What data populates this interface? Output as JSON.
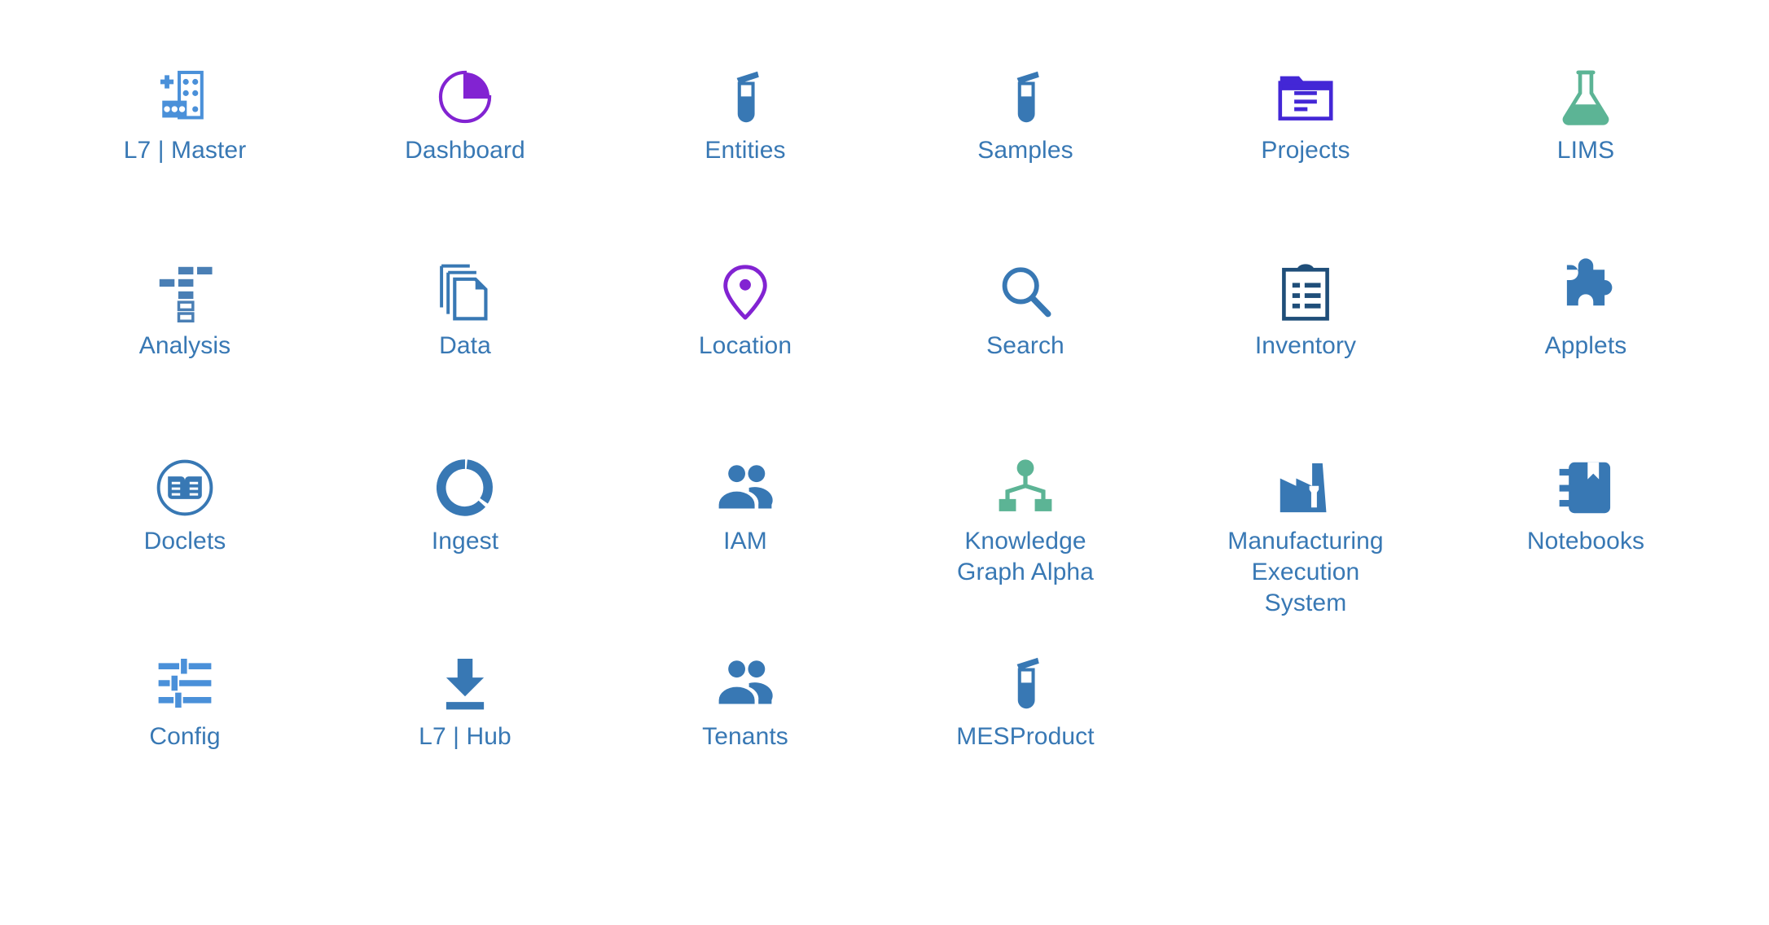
{
  "page": {
    "title": "App Launcher",
    "background_color": "#ffffff",
    "label_color": "#3878b4",
    "columns": 6
  },
  "palette": {
    "blue_light": "#4a90d9",
    "blue_mid": "#3878b4",
    "blue_steel": "#4a7fb5",
    "navy": "#1f4e79",
    "purple": "#8223d2",
    "indigo": "#4327d6",
    "green": "#5cb495"
  },
  "apps": [
    {
      "id": "l7-master",
      "label": "L7 | Master",
      "icon": "master-grid-icon",
      "color": "#4a90d9"
    },
    {
      "id": "dashboard",
      "label": "Dashboard",
      "icon": "pie-chart-icon",
      "color": "#8223d2"
    },
    {
      "id": "entities",
      "label": "Entities",
      "icon": "test-tube-icon",
      "color": "#3878b4"
    },
    {
      "id": "samples",
      "label": "Samples",
      "icon": "test-tube-icon",
      "color": "#3878b4"
    },
    {
      "id": "projects",
      "label": "Projects",
      "icon": "folder-document-icon",
      "color": "#4327d6"
    },
    {
      "id": "lims",
      "label": "LIMS",
      "icon": "flask-icon",
      "color": "#5cb495"
    },
    {
      "id": "analysis",
      "label": "Analysis",
      "icon": "workflow-blocks-icon",
      "color": "#4a7fb5"
    },
    {
      "id": "data",
      "label": "Data",
      "icon": "documents-stack-icon",
      "color": "#3878b4"
    },
    {
      "id": "location",
      "label": "Location",
      "icon": "map-pin-icon",
      "color": "#8223d2"
    },
    {
      "id": "search",
      "label": "Search",
      "icon": "search-icon",
      "color": "#3878b4"
    },
    {
      "id": "inventory",
      "label": "Inventory",
      "icon": "clipboard-list-icon",
      "color": "#1f4e79"
    },
    {
      "id": "applets",
      "label": "Applets",
      "icon": "puzzle-piece-icon",
      "color": "#3878b4"
    },
    {
      "id": "doclets",
      "label": "Doclets",
      "icon": "book-circle-icon",
      "color": "#3878b4"
    },
    {
      "id": "ingest",
      "label": "Ingest",
      "icon": "donut-ring-icon",
      "color": "#3878b4"
    },
    {
      "id": "iam",
      "label": "IAM",
      "icon": "users-icon",
      "color": "#3878b4"
    },
    {
      "id": "knowledge-graph-alpha",
      "label": "Knowledge\nGraph Alpha",
      "icon": "sitemap-icon",
      "color": "#5cb495"
    },
    {
      "id": "manufacturing-execution-system",
      "label": "Manufacturing\nExecution\nSystem",
      "icon": "factory-vial-icon",
      "color": "#3878b4"
    },
    {
      "id": "notebooks",
      "label": "Notebooks",
      "icon": "notebook-icon",
      "color": "#3878b4"
    },
    {
      "id": "config",
      "label": "Config",
      "icon": "sliders-icon",
      "color": "#4a90d9"
    },
    {
      "id": "l7-hub",
      "label": "L7 | Hub",
      "icon": "download-arrow-icon",
      "color": "#3878b4"
    },
    {
      "id": "tenants",
      "label": "Tenants",
      "icon": "users-icon",
      "color": "#3878b4"
    },
    {
      "id": "mesproduct",
      "label": "MESProduct",
      "icon": "test-tube-icon",
      "color": "#3878b4"
    }
  ]
}
